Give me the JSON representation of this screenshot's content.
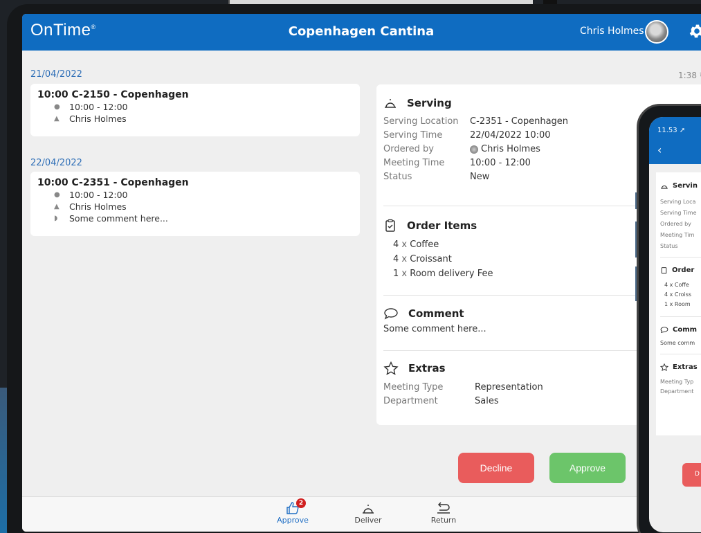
{
  "app": {
    "logo": "OnTime",
    "title": "Copenhagen Cantina",
    "user_name": "Chris Holmes",
    "sync_time": "1:38"
  },
  "bookings": [
    {
      "date": "21/04/2022",
      "title": "10:00  C-2150 - Copenhagen",
      "time": "10:00 - 12:00",
      "person": "Chris Holmes"
    },
    {
      "date": "22/04/2022",
      "title": "10:00  C-2351 - Copenhagen",
      "time": "10:00 - 12:00",
      "person": "Chris Holmes",
      "comment": "Some comment here..."
    }
  ],
  "detail": {
    "serving": {
      "heading": "Serving",
      "rows": [
        {
          "label": "Serving Location",
          "value": "C-2351 - Copenhagen"
        },
        {
          "label": "Serving Time",
          "value": "22/04/2022 10:00"
        },
        {
          "label": "Ordered by",
          "value": "Chris Holmes"
        },
        {
          "label": "Meeting Time",
          "value": "10:00 - 12:00"
        },
        {
          "label": "Status",
          "value": "New"
        }
      ]
    },
    "order_items": {
      "heading": "Order Items",
      "items": [
        {
          "qty": "4",
          "x": "x",
          "name": "Coffee"
        },
        {
          "qty": "4",
          "x": "x",
          "name": "Croissant"
        },
        {
          "qty": "1",
          "x": "x",
          "name": "Room delivery Fee"
        }
      ]
    },
    "comment": {
      "heading": "Comment",
      "text": "Some comment here..."
    },
    "extras": {
      "heading": "Extras",
      "rows": [
        {
          "label": "Meeting Type",
          "value": "Representation"
        },
        {
          "label": "Department",
          "value": "Sales"
        }
      ]
    }
  },
  "actions": {
    "decline": "Decline",
    "approve": "Approve"
  },
  "tabs": [
    {
      "label": "Approve",
      "badge": "2"
    },
    {
      "label": "Deliver"
    },
    {
      "label": "Return"
    }
  ],
  "phone": {
    "time": "11.53",
    "sections": {
      "serving": "Servin",
      "rows": [
        "Serving Loca",
        "Serving Time",
        "Ordered by",
        "Meeting Tim",
        "Status"
      ],
      "order": "Order",
      "items": [
        "4 x Coffe",
        "4 x Croiss",
        "1 x Room"
      ],
      "comment": "Comm",
      "comment_text": "Some comm",
      "extras": "Extras",
      "extras_rows": [
        "Meeting Typ",
        "Department"
      ],
      "button": "D"
    }
  },
  "colors": {
    "brand": "#0f6cc1",
    "decline": "#e95c5c",
    "approve": "#6cc56a",
    "badge": "#d02020"
  }
}
